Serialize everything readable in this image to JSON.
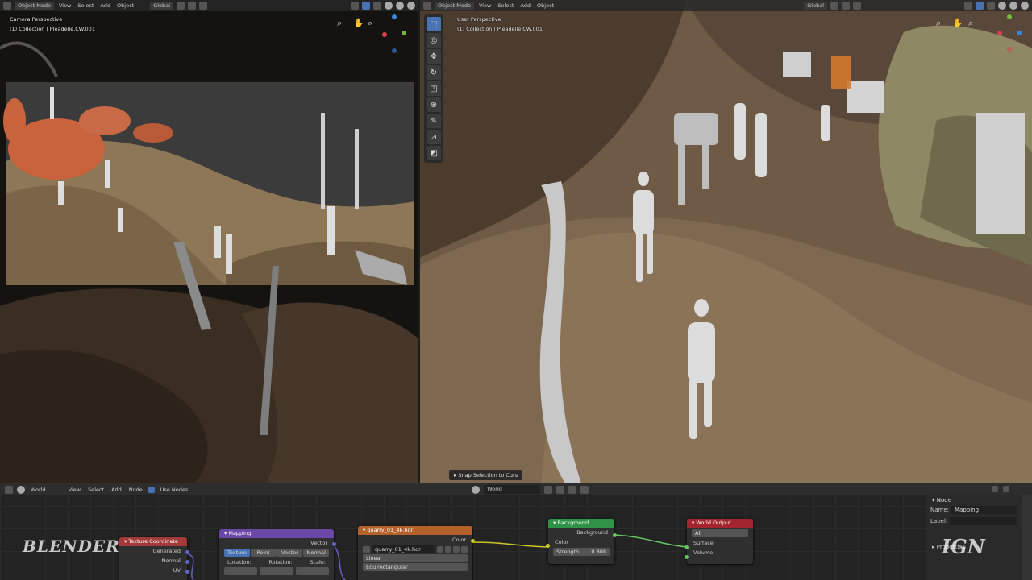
{
  "left_viewport": {
    "header": {
      "mode": "Object Mode",
      "menu": [
        "View",
        "Select",
        "Add",
        "Object"
      ],
      "transform": "Global"
    },
    "title": "Camera Perspective",
    "collection": "(1) Collection | Pleadelle.CW.001"
  },
  "right_viewport": {
    "header": {
      "mode": "Object Mode",
      "menu": [
        "View",
        "Select",
        "Add",
        "Object"
      ],
      "transform": "Global"
    },
    "title": "User Perspective",
    "collection": "(1) Collection | Pleadelle.CW.001",
    "tools": [
      "select-box-icon",
      "cursor-icon",
      "move-icon",
      "rotate-icon",
      "scale-icon",
      "transform-icon",
      "annotate-icon",
      "measure-icon",
      "add-cube-icon"
    ],
    "operator_panel": "Snap Selection to Curs"
  },
  "node_editor": {
    "header": {
      "editor_type": "World",
      "menu": [
        "View",
        "Select",
        "Add",
        "Node"
      ],
      "use_nodes_label": "Use Nodes",
      "world_name": "World"
    },
    "nodes": {
      "texture_coordinate": {
        "title": "Texture Coordinate",
        "outputs": [
          "Generated",
          "Normal",
          "UV"
        ],
        "color": "#a33a3a"
      },
      "mapping": {
        "title": "Mapping",
        "output": "Vector",
        "types": [
          "Texture",
          "Point",
          "Vector",
          "Normal"
        ],
        "labels": [
          "Location:",
          "Rotation:",
          "Scale:"
        ],
        "color": "#6b48a8"
      },
      "env_texture": {
        "title": "quarry_01_4k.hdr",
        "output": "Color",
        "image_name": "quarry_01_4k.hdr",
        "interpolation": "Linear",
        "projection": "Equirectangular",
        "color": "#b5612a"
      },
      "background": {
        "title": "Background",
        "output": "Background",
        "inputs": [
          "Color"
        ],
        "strength_label": "Strength",
        "strength_value": "0.808",
        "color": "#2f9246"
      },
      "world_output": {
        "title": "World Output",
        "target": "All",
        "inputs": [
          "Surface",
          "Volume"
        ],
        "color": "#a3262e"
      }
    },
    "sidebar": {
      "section": "Node",
      "name_label": "Name:",
      "name_value": "Mapping",
      "label_label": "Label:",
      "properties_label": "Properties"
    }
  },
  "watermarks": {
    "left": "BLENDER",
    "right": "IGN"
  }
}
